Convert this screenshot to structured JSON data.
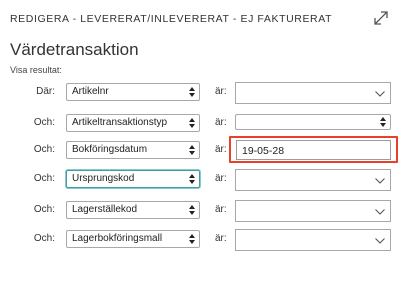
{
  "header": {
    "title": "REDIGERA - LEVERERAT/INLEVERERAT - EJ FAKTURERAT",
    "expand_icon": "expand-diagonal-icon"
  },
  "page_title": "Värdetransaktion",
  "show_results_label": "Visa resultat:",
  "filters": [
    {
      "condition": "Där:",
      "field": "Artikelnr",
      "operator": "är:",
      "value": "",
      "value_type": "dropdown"
    },
    {
      "condition": "Och:",
      "field": "Artikeltransaktionstyp",
      "operator": "är:",
      "value": "",
      "value_type": "dropdown-compact"
    },
    {
      "condition": "Och:",
      "field": "Bokföringsdatum",
      "operator": "är:",
      "value": "19-05-28",
      "value_type": "text"
    },
    {
      "condition": "Och:",
      "field": "Ursprungskod",
      "operator": "är:",
      "value": "",
      "value_type": "dropdown",
      "focused": true
    },
    {
      "condition": "Och:",
      "field": "Lagerställekod",
      "operator": "är:",
      "value": "",
      "value_type": "dropdown"
    },
    {
      "condition": "Och:",
      "field": "Lagerbokföringsmall",
      "operator": "är:",
      "value": "",
      "value_type": "dropdown"
    }
  ],
  "colors": {
    "highlight": "#e8412a",
    "focus": "#3f9ea6"
  }
}
